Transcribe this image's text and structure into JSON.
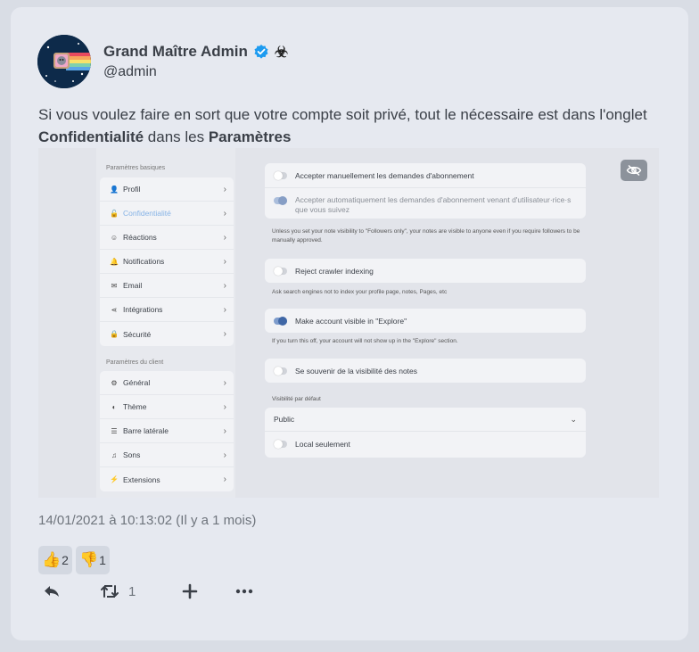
{
  "note": {
    "author_name": "Grand Maître Admin",
    "author_handle": "@admin",
    "badge_icon": "verified-check-icon",
    "emoji_icon": "biohazard-icon",
    "text_parts": {
      "p1": "Si vous voulez faire en sort que votre compte soit privé, tout le nécessaire est dans l'onglet ",
      "b1": "Confidentialité",
      "p2": " dans les ",
      "b2": "Paramètres"
    },
    "timestamp": "14/01/2021 à 10:13:02 (Il y a 1 mois)",
    "reactions": [
      {
        "emoji": "👍",
        "count": "2"
      },
      {
        "emoji": "👎",
        "count": "1"
      }
    ],
    "renote_count": "1"
  },
  "screenshot": {
    "section_basic": "Paramètres basiques",
    "basic_items": [
      {
        "icon": "👤",
        "label": "Profil"
      },
      {
        "icon": "🔓",
        "label": "Confidentialité"
      },
      {
        "icon": "☺",
        "label": "Réactions"
      },
      {
        "icon": "🔔",
        "label": "Notifications"
      },
      {
        "icon": "✉",
        "label": "Email"
      },
      {
        "icon": "⋖",
        "label": "Intégrations"
      },
      {
        "icon": "🔒",
        "label": "Sécurité"
      }
    ],
    "section_client": "Paramètres du client",
    "client_items": [
      {
        "icon": "⚙",
        "label": "Général"
      },
      {
        "icon": "◐",
        "label": "Thème"
      },
      {
        "icon": "☰",
        "label": "Barre latérale"
      },
      {
        "icon": "♫",
        "label": "Sons"
      },
      {
        "icon": "⚡",
        "label": "Extensions"
      }
    ],
    "toggle_manual": "Accepter manuellement les demandes d'abonnement",
    "toggle_auto": "Accepter automatiquement les demandes d'abonnement venant d'utilisateur·rice·s que vous suivez",
    "note_visibility": "Unless you set your note visibility to \"Followers only\", your notes are visible to anyone even if you require followers to be manually approved.",
    "toggle_crawler": "Reject crawler indexing",
    "note_crawler": "Ask search engines not to index your profile page, notes, Pages, etc",
    "toggle_explore": "Make account visible in \"Explore\"",
    "note_explore": "If you turn this off, your account will not show up in the \"Explore\" section.",
    "toggle_remember": "Se souvenir de la visibilité des notes",
    "default_visibility_label": "Visibilité par défaut",
    "default_visibility_value": "Public",
    "toggle_local": "Local seulement"
  }
}
